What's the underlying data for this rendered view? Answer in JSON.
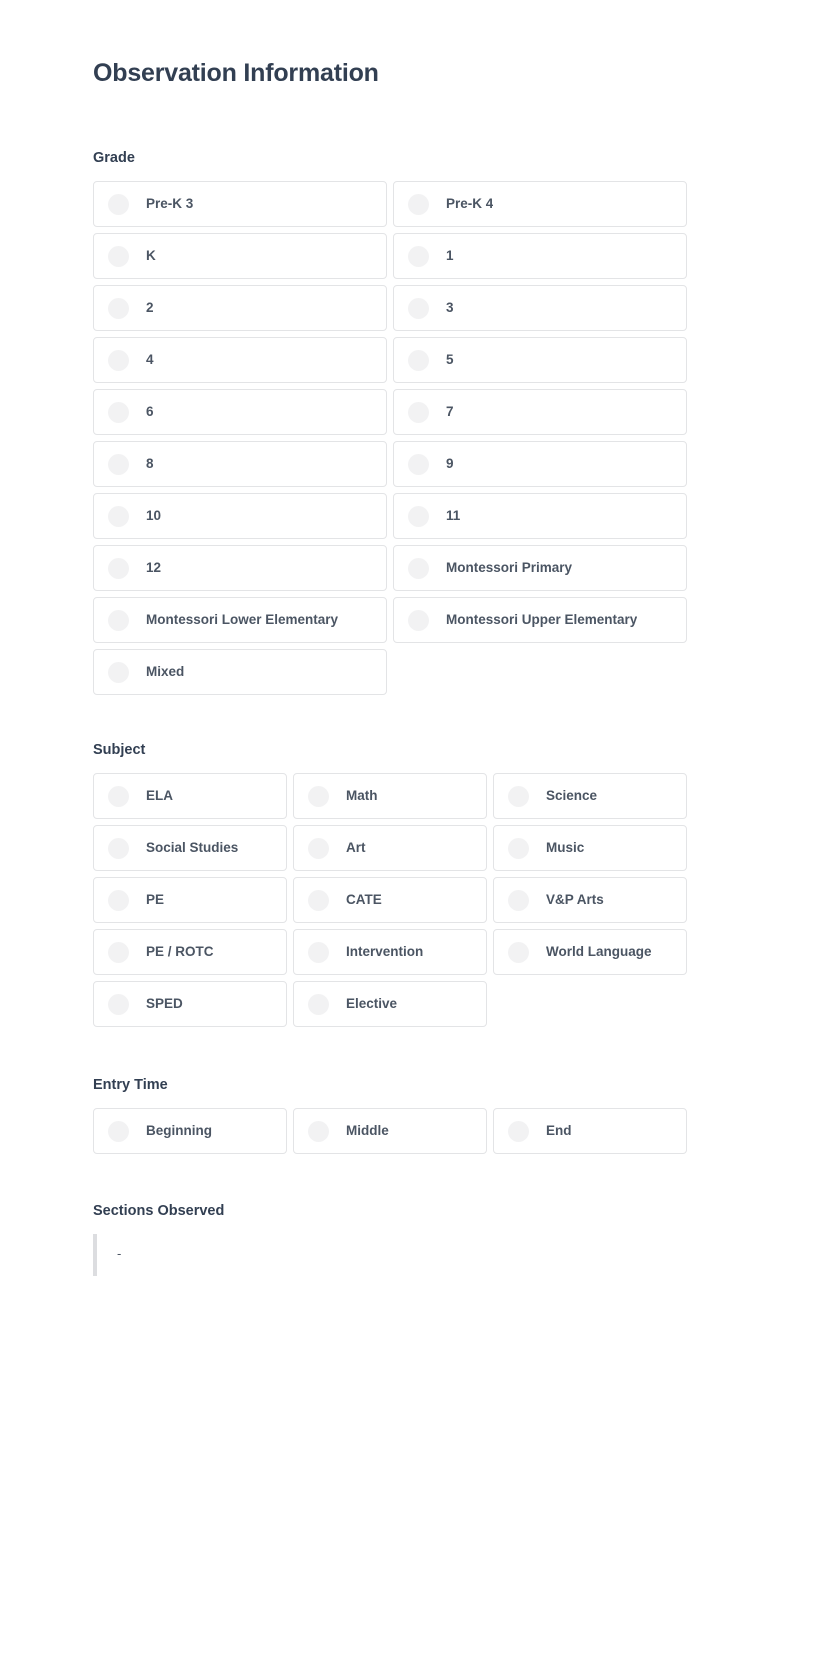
{
  "header": {
    "title": "Observation Information"
  },
  "sections": {
    "grade": {
      "label": "Grade",
      "options": [
        "Pre-K 3",
        "Pre-K 4",
        "K",
        "1",
        "2",
        "3",
        "4",
        "5",
        "6",
        "7",
        "8",
        "9",
        "10",
        "11",
        "12",
        "Montessori Primary",
        "Montessori Lower Elementary",
        "Montessori Upper Elementary",
        "Mixed"
      ]
    },
    "subject": {
      "label": "Subject",
      "options": [
        "ELA",
        "Math",
        "Science",
        "Social Studies",
        "Art",
        "Music",
        "PE",
        "CATE",
        "V&P Arts",
        "PE / ROTC",
        "Intervention",
        "World Language",
        "SPED",
        "Elective"
      ]
    },
    "entry_time": {
      "label": "Entry Time",
      "options": [
        "Beginning",
        "Middle",
        "End"
      ]
    },
    "sections_observed": {
      "label": "Sections Observed",
      "value": "-"
    }
  },
  "colors": {
    "heading": "#323f52",
    "label": "#4b5563",
    "border": "#e3e4e6",
    "radio": "#f2f2f3",
    "quote_bar": "#dcdde0"
  }
}
